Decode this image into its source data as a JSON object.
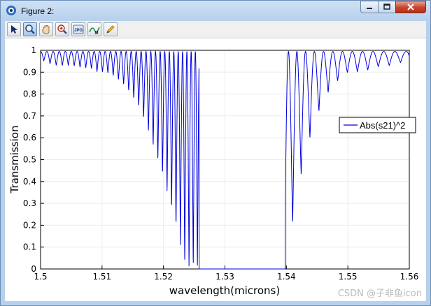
{
  "window": {
    "title": "Figure 2:"
  },
  "toolbar": {
    "tools": [
      {
        "name": "select-tool",
        "icon": "arrow-cursor-icon"
      },
      {
        "name": "zoom-tool",
        "icon": "magnifier-icon",
        "active": true
      },
      {
        "name": "pan-tool",
        "icon": "hand-icon"
      },
      {
        "name": "zoom-extents-tool",
        "icon": "magnifier-plus-icon"
      },
      {
        "name": "export-jpg-tool",
        "icon": "jpg-export-icon",
        "label": "JPG"
      },
      {
        "name": "data-marker-tool",
        "icon": "curve-marker-icon",
        "label": "M"
      },
      {
        "name": "edit-tool",
        "icon": "pencil-icon"
      }
    ]
  },
  "chart_data": {
    "type": "line",
    "title": "",
    "xlabel": "wavelength(microns)",
    "ylabel": "Transmission",
    "xlim": [
      1.5,
      1.56
    ],
    "ylim": [
      0,
      1
    ],
    "x_ticks": [
      "1.5",
      "1.51",
      "1.52",
      "1.53",
      "1.54",
      "1.55",
      "1.56"
    ],
    "y_ticks": [
      "0",
      "0.1",
      "0.2",
      "0.3",
      "0.4",
      "0.5",
      "0.6",
      "0.7",
      "0.8",
      "0.9",
      "1"
    ],
    "grid": true,
    "legend": {
      "position": "right",
      "entries": [
        "Abs(s21)^2"
      ]
    },
    "series": [
      {
        "name": "Abs(s21)^2",
        "color": "#0000dd",
        "notes_on_shape": "oscillating ripple near 1 with dips deepening toward a stopband",
        "x": [
          1.5,
          1.5013,
          1.5027,
          1.504,
          1.5053,
          1.5067,
          1.508,
          1.5093,
          1.5107,
          1.512,
          1.5133,
          1.5147,
          1.516,
          1.5173,
          1.5187,
          1.52,
          1.5213,
          1.5227,
          1.5236,
          1.5246,
          1.5253,
          1.5257,
          1.526,
          1.5395,
          1.54,
          1.5404,
          1.5414,
          1.5424,
          1.5433,
          1.5447,
          1.546,
          1.5473,
          1.5487,
          1.55,
          1.5513,
          1.5527,
          1.554,
          1.5553,
          1.5567,
          1.558,
          1.5593,
          1.56
        ],
        "minima": [
          0.96,
          0.94,
          0.93,
          0.93,
          0.93,
          0.92,
          0.92,
          0.9,
          0.9,
          0.88,
          0.85,
          0.8,
          0.74,
          0.65,
          0.53,
          0.41,
          0.27,
          0.11,
          0.0,
          0.0,
          0.0,
          0.0,
          0.0,
          0.0,
          0.0,
          0.12,
          0.26,
          0.43,
          0.55,
          0.68,
          0.77,
          0.83,
          0.87,
          0.9,
          0.9,
          0.91,
          0.91,
          0.93,
          0.93,
          0.94,
          0.95,
          0.93
        ]
      }
    ]
  },
  "watermark": "CSDN @子非鱼icon"
}
